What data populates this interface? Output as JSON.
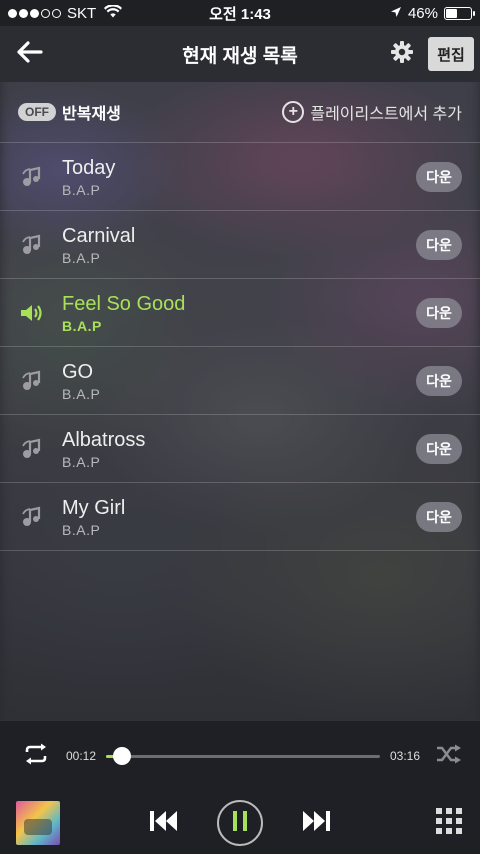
{
  "status_bar": {
    "carrier": "SKT",
    "time": "오전 1:43",
    "battery": "46%",
    "battery_level": 0.46
  },
  "header": {
    "title": "현재 재생 목록",
    "edit_label": "편집"
  },
  "toolbar": {
    "repeat_toggle": "OFF",
    "repeat_label": "반복재생",
    "add_playlist_label": "플레이리스트에서 추가"
  },
  "playlist": [
    {
      "title": "Today",
      "artist": "B.A.P",
      "download_label": "다운",
      "playing": false
    },
    {
      "title": "Carnival",
      "artist": "B.A.P",
      "download_label": "다운",
      "playing": false
    },
    {
      "title": "Feel So Good",
      "artist": "B.A.P",
      "download_label": "다운",
      "playing": true
    },
    {
      "title": "GO",
      "artist": "B.A.P",
      "download_label": "다운",
      "playing": false
    },
    {
      "title": "Albatross",
      "artist": "B.A.P",
      "download_label": "다운",
      "playing": false
    },
    {
      "title": "My Girl",
      "artist": "B.A.P",
      "download_label": "다운",
      "playing": false
    }
  ],
  "player": {
    "elapsed": "00:12",
    "duration": "03:16",
    "progress": 0.06
  },
  "colors": {
    "accent": "#a8e05a",
    "header_bg": "#2c2d33",
    "player_bg": "#1e1f24"
  },
  "icons": {
    "back": "back-arrow-icon",
    "settings": "gear-icon",
    "add": "plus-circle-icon",
    "track_idle": "music-note-icon",
    "track_playing": "speaker-icon",
    "repeat": "repeat-icon",
    "shuffle": "shuffle-icon",
    "previous": "skip-previous-icon",
    "pause": "pause-icon",
    "next": "skip-next-icon",
    "menu": "grid-menu-icon"
  }
}
